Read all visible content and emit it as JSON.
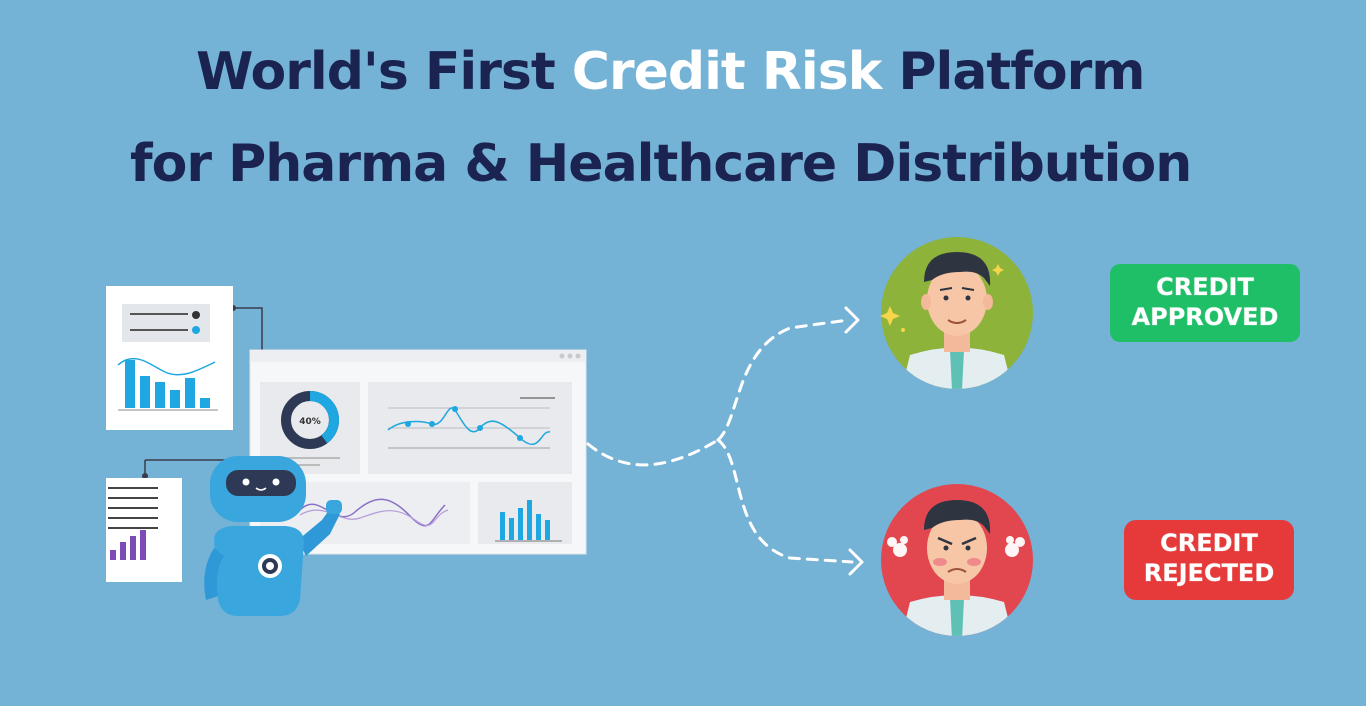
{
  "headline": {
    "line1_pre": "World's First ",
    "line1_highlight": "Credit Risk",
    "line1_post": " Platform",
    "line2": "for Pharma & Healthcare Distribution"
  },
  "badges": {
    "approved": [
      "CREDIT",
      "APPROVED"
    ],
    "rejected": [
      "CREDIT",
      "REJECTED"
    ]
  },
  "dashboard": {
    "donut_label": "40%"
  },
  "colors": {
    "background": "#74b2d6",
    "headline": "#1b2350",
    "approved": "#1fbf68",
    "rejected": "#e63a3a",
    "happy_avatar_bg": "#8db33a",
    "angry_avatar_bg": "#e2474f",
    "chart_accent": "#1ea7e0",
    "robot": "#39a6de"
  },
  "icons": [
    "robot-mascot",
    "happy-person-avatar",
    "angry-person-avatar",
    "dashed-arrow"
  ]
}
